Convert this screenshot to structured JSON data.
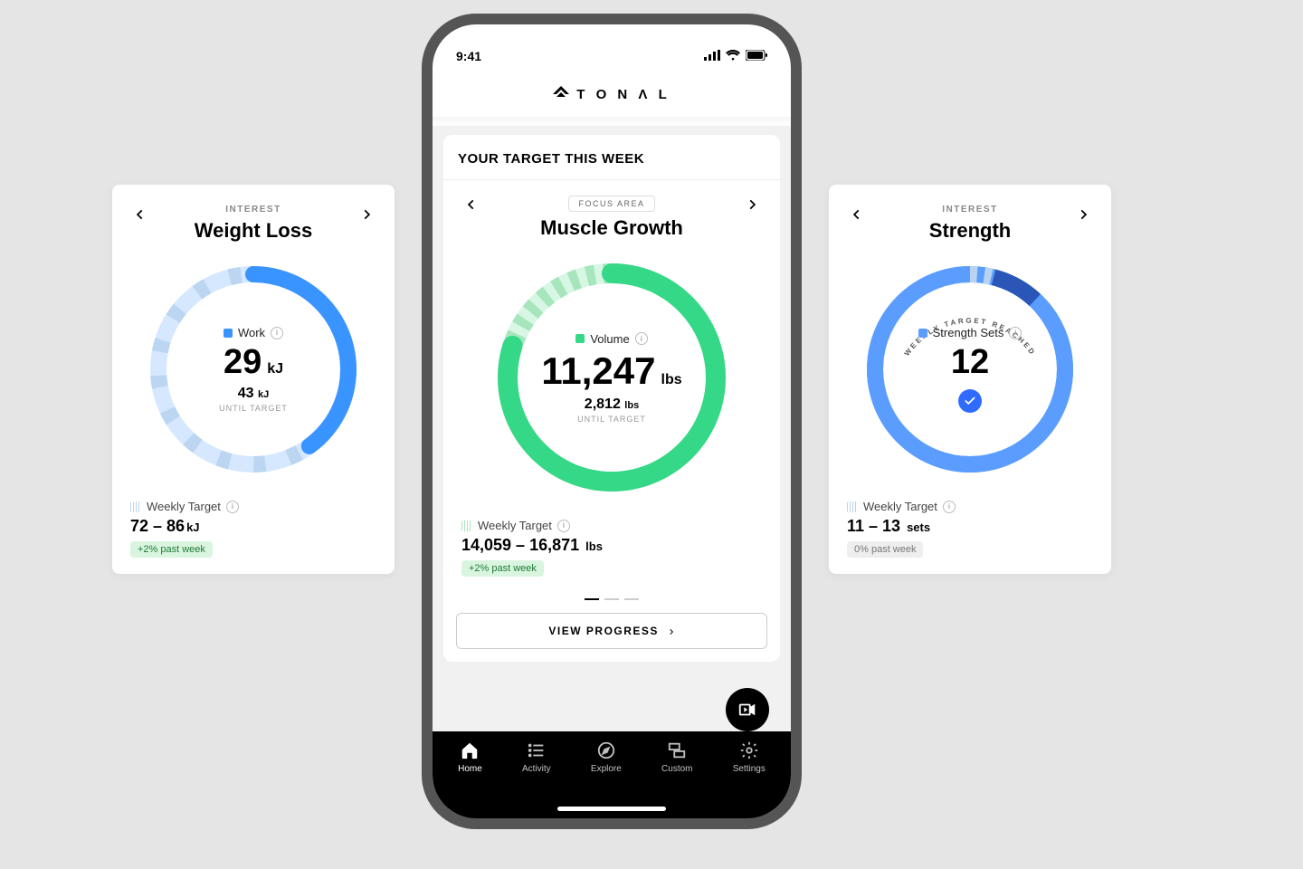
{
  "status": {
    "time": "9:41"
  },
  "brand": "T O N Λ L",
  "section_title": "YOUR TARGET THIS WEEK",
  "view_progress": "VIEW PROGRESS",
  "nav": {
    "home": "Home",
    "activity": "Activity",
    "explore": "Explore",
    "custom": "Custom",
    "settings": "Settings"
  },
  "cards": {
    "left": {
      "type_label": "INTEREST",
      "title": "Weight Loss",
      "metric_label": "Work",
      "value": "29",
      "unit": "kJ",
      "remain_value": "43",
      "remain_unit": "kJ",
      "remain_label": "UNTIL TARGET",
      "wt_label": "Weekly Target",
      "range": "72 – 86",
      "range_unit": "kJ",
      "badge": "+2% past week",
      "accent": "#3a94ff",
      "accent_light": "#d5e8ff",
      "progress": 0.4,
      "stripe_start": 0.0,
      "stripe_end": 0.15
    },
    "center": {
      "type_label": "FOCUS AREA",
      "title": "Muscle Growth",
      "metric_label": "Volume",
      "value": "11,247",
      "unit": "lbs",
      "remain_value": "2,812",
      "remain_unit": "lbs",
      "remain_label": "UNTIL TARGET",
      "wt_label": "Weekly Target",
      "range": "14,059 – 16,871",
      "range_unit": "lbs",
      "badge": "+2% past week",
      "accent": "#35d886",
      "accent_light": "#bff1d3",
      "progress": 0.8,
      "stripe_start": 0.0,
      "stripe_end": 0.15
    },
    "right": {
      "type_label": "INTEREST",
      "title": "Strength",
      "metric_label": "Strength Sets",
      "value": "12",
      "unit": "",
      "arc_label": "WEEKLY TARGET REACHED",
      "wt_label": "Weekly Target",
      "range": "11 – 13",
      "range_unit": "sets",
      "badge": "0% past week",
      "accent": "#5a9dff",
      "accent_light": "#d3e5ff",
      "progress": 1.0,
      "stripe_start": 0.0,
      "stripe_end": 0.1,
      "dark_start": 0.04,
      "dark_end": 0.12
    }
  },
  "chart_data": [
    {
      "type": "pie",
      "title": "Weight Loss — Work progress",
      "series": [
        {
          "name": "completed",
          "values": [
            29
          ]
        },
        {
          "name": "remaining",
          "values": [
            43
          ]
        }
      ],
      "annotations": [
        "target range 72–86 kJ"
      ]
    },
    {
      "type": "pie",
      "title": "Muscle Growth — Volume progress",
      "series": [
        {
          "name": "completed",
          "values": [
            11247
          ]
        },
        {
          "name": "remaining",
          "values": [
            2812
          ]
        }
      ],
      "annotations": [
        "target range 14,059–16,871 lbs"
      ]
    },
    {
      "type": "pie",
      "title": "Strength — Strength Sets progress",
      "series": [
        {
          "name": "completed",
          "values": [
            12
          ]
        },
        {
          "name": "remaining",
          "values": [
            0
          ]
        }
      ],
      "annotations": [
        "target range 11–13 sets",
        "weekly target reached"
      ]
    }
  ]
}
